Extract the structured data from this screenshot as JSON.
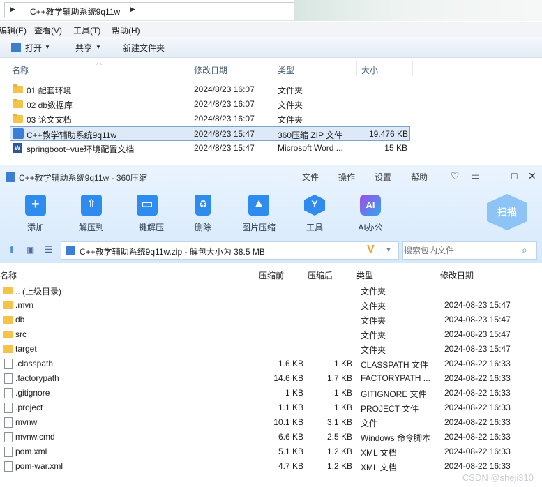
{
  "explorer": {
    "breadcrumb": "C++教学辅助系统9q11w",
    "menu": [
      "编辑(E)",
      "查看(V)",
      "工具(T)",
      "帮助(H)"
    ],
    "toolbar": {
      "open": "打开",
      "share": "共享",
      "new_folder": "新建文件夹"
    },
    "columns": {
      "name": "名称",
      "date": "修改日期",
      "type": "类型",
      "size": "大小"
    },
    "files": [
      {
        "name": "01 配套环境",
        "date": "2024/8/23 16:07",
        "type": "文件夹",
        "size": "",
        "icon": "folder-icon"
      },
      {
        "name": "02 db数据库",
        "date": "2024/8/23 16:07",
        "type": "文件夹",
        "size": "",
        "icon": "folder-icon"
      },
      {
        "name": "03 论文文档",
        "date": "2024/8/23 16:07",
        "type": "文件夹",
        "size": "",
        "icon": "folder-icon"
      },
      {
        "name": "C++教学辅助系统9q11w",
        "date": "2024/8/23 15:47",
        "type": "360压缩 ZIP 文件",
        "size": "19,476 KB",
        "icon": "zip-icon"
      },
      {
        "name": "springboot+vue环境配置文档",
        "date": "2024/8/23 15:47",
        "type": "Microsoft Word ...",
        "size": "15 KB",
        "icon": "word-icon"
      }
    ]
  },
  "zip": {
    "title": "C++教学辅助系统9q11w - 360压缩",
    "menu": [
      "文件",
      "操作",
      "设置",
      "帮助"
    ],
    "tools": [
      "添加",
      "解压到",
      "一键解压",
      "删除",
      "图片压缩",
      "工具",
      "AI办公"
    ],
    "scan": "扫描",
    "path": "C++教学辅助系统9q11w.zip - 解包大小为 38.5 MB",
    "search_placeholder": "搜索包内文件",
    "columns": {
      "name": "名称",
      "packed": "压缩前",
      "compressed": "压缩后",
      "type": "类型",
      "date": "修改日期"
    },
    "rows": [
      {
        "name": ".. (上级目录)",
        "before": "",
        "after": "",
        "type": "文件夹",
        "date": "",
        "icon": "folder-icon"
      },
      {
        "name": ".mvn",
        "before": "",
        "after": "",
        "type": "文件夹",
        "date": "2024-08-23 15:47",
        "icon": "folder-icon"
      },
      {
        "name": "db",
        "before": "",
        "after": "",
        "type": "文件夹",
        "date": "2024-08-23 15:47",
        "icon": "folder-icon"
      },
      {
        "name": "src",
        "before": "",
        "after": "",
        "type": "文件夹",
        "date": "2024-08-23 15:47",
        "icon": "folder-icon"
      },
      {
        "name": "target",
        "before": "",
        "after": "",
        "type": "文件夹",
        "date": "2024-08-23 15:47",
        "icon": "folder-icon"
      },
      {
        "name": ".classpath",
        "before": "1.6 KB",
        "after": "1 KB",
        "type": "CLASSPATH 文件",
        "date": "2024-08-22 16:33",
        "icon": "file-icon"
      },
      {
        "name": ".factorypath",
        "before": "14.6 KB",
        "after": "1.7 KB",
        "type": "FACTORYPATH ...",
        "date": "2024-08-22 16:33",
        "icon": "file-icon"
      },
      {
        "name": ".gitignore",
        "before": "1 KB",
        "after": "1 KB",
        "type": "GITIGNORE 文件",
        "date": "2024-08-22 16:33",
        "icon": "file-icon"
      },
      {
        "name": ".project",
        "before": "1.1 KB",
        "after": "1 KB",
        "type": "PROJECT 文件",
        "date": "2024-08-22 16:33",
        "icon": "file-icon"
      },
      {
        "name": "mvnw",
        "before": "10.1 KB",
        "after": "3.1 KB",
        "type": "文件",
        "date": "2024-08-22 16:33",
        "icon": "file-icon"
      },
      {
        "name": "mvnw.cmd",
        "before": "6.6 KB",
        "after": "2.5 KB",
        "type": "Windows 命令脚本",
        "date": "2024-08-22 16:33",
        "icon": "cmd-icon"
      },
      {
        "name": "pom.xml",
        "before": "5.1 KB",
        "after": "1.2 KB",
        "type": "XML 文档",
        "date": "2024-08-22 16:33",
        "icon": "xml-icon"
      },
      {
        "name": "pom-war.xml",
        "before": "4.7 KB",
        "after": "1.2 KB",
        "type": "XML 文档",
        "date": "2024-08-22 16:33",
        "icon": "xml-icon"
      }
    ]
  },
  "watermark": "CSDN @sheji310"
}
